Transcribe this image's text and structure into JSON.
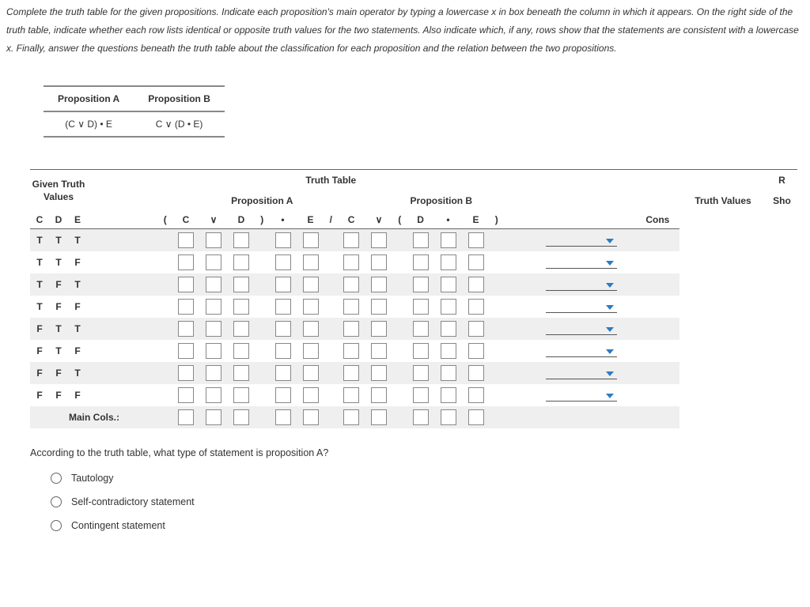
{
  "instructions": "Complete the truth table for the given propositions. Indicate each proposition's main operator by typing a lowercase x in box beneath the column in which it appears. On the right side of the truth table, indicate whether each row lists identical or opposite truth values for the two statements. Also indicate which, if any, rows show that the statements are consistent with a lowercase x. Finally, answer the questions beneath the truth table about the classification for each proposition and the relation between the two propositions.",
  "prop_header": {
    "a": "Proposition A",
    "b": "Proposition B"
  },
  "prop_values": {
    "a": "(C ∨ D) • E",
    "b": "C ∨ (D • E)"
  },
  "tt_labels": {
    "given": "Given Truth Values",
    "truth_table": "Truth Table",
    "prop_a": "Proposition A",
    "prop_b": "Proposition B",
    "truth_values": "Truth Values",
    "r": "R",
    "sho": "Sho",
    "cons": "Cons",
    "main_cols": "Main Cols.:"
  },
  "var_headers": [
    "C",
    "D",
    "E"
  ],
  "sym_a": [
    "(",
    "C",
    "∨",
    "D",
    ")",
    "•",
    "E",
    "/"
  ],
  "sym_b": [
    "C",
    "∨",
    "(",
    "D",
    "•",
    "E",
    ")"
  ],
  "rows": [
    {
      "c": "T",
      "d": "T",
      "e": "T"
    },
    {
      "c": "T",
      "d": "T",
      "e": "F"
    },
    {
      "c": "T",
      "d": "F",
      "e": "T"
    },
    {
      "c": "T",
      "d": "F",
      "e": "F"
    },
    {
      "c": "F",
      "d": "T",
      "e": "T"
    },
    {
      "c": "F",
      "d": "T",
      "e": "F"
    },
    {
      "c": "F",
      "d": "F",
      "e": "T"
    },
    {
      "c": "F",
      "d": "F",
      "e": "F"
    }
  ],
  "question_a": "According to the truth table, what type of statement is proposition A?",
  "options_a": [
    "Tautology",
    "Self-contradictory statement",
    "Contingent statement"
  ]
}
